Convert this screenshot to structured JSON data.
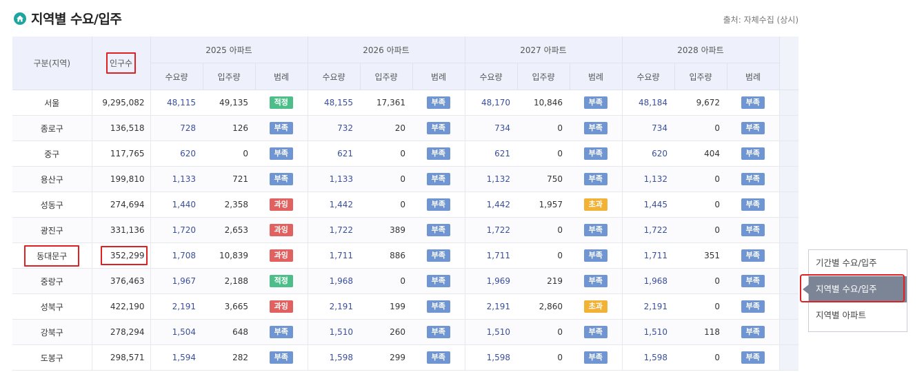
{
  "page": {
    "title": "지역별 수요/입주",
    "source": "출처: 자체수집 (상시)"
  },
  "table": {
    "col_region": "구분(지역)",
    "col_population": "인구수",
    "years": [
      "2025 아파트",
      "2026 아파트",
      "2027 아파트",
      "2028 아파트"
    ],
    "sub_demand": "수요량",
    "sub_supply": "입주량",
    "sub_legend": "범례",
    "rows": [
      {
        "region": "서울",
        "population": "9,295,082",
        "y": [
          [
            "48,115",
            "49,135",
            "적정"
          ],
          [
            "48,155",
            "17,361",
            "부족"
          ],
          [
            "48,170",
            "10,846",
            "부족"
          ],
          [
            "48,184",
            "9,672",
            "부족"
          ]
        ]
      },
      {
        "region": "종로구",
        "population": "136,518",
        "y": [
          [
            "728",
            "126",
            "부족"
          ],
          [
            "732",
            "20",
            "부족"
          ],
          [
            "734",
            "0",
            "부족"
          ],
          [
            "734",
            "0",
            "부족"
          ]
        ]
      },
      {
        "region": "중구",
        "population": "117,765",
        "y": [
          [
            "620",
            "0",
            "부족"
          ],
          [
            "621",
            "0",
            "부족"
          ],
          [
            "621",
            "0",
            "부족"
          ],
          [
            "620",
            "404",
            "부족"
          ]
        ]
      },
      {
        "region": "용산구",
        "population": "199,810",
        "y": [
          [
            "1,133",
            "721",
            "부족"
          ],
          [
            "1,133",
            "0",
            "부족"
          ],
          [
            "1,132",
            "750",
            "부족"
          ],
          [
            "1,132",
            "0",
            "부족"
          ]
        ]
      },
      {
        "region": "성동구",
        "population": "274,694",
        "y": [
          [
            "1,440",
            "2,358",
            "과잉"
          ],
          [
            "1,442",
            "0",
            "부족"
          ],
          [
            "1,442",
            "1,957",
            "초과"
          ],
          [
            "1,445",
            "0",
            "부족"
          ]
        ]
      },
      {
        "region": "광진구",
        "population": "331,136",
        "y": [
          [
            "1,720",
            "2,653",
            "과잉"
          ],
          [
            "1,722",
            "389",
            "부족"
          ],
          [
            "1,722",
            "0",
            "부족"
          ],
          [
            "1,722",
            "0",
            "부족"
          ]
        ]
      },
      {
        "region": "동대문구",
        "population": "352,299",
        "y": [
          [
            "1,708",
            "10,839",
            "과잉"
          ],
          [
            "1,711",
            "886",
            "부족"
          ],
          [
            "1,711",
            "0",
            "부족"
          ],
          [
            "1,711",
            "351",
            "부족"
          ]
        ]
      },
      {
        "region": "중랑구",
        "population": "376,463",
        "y": [
          [
            "1,967",
            "2,188",
            "적정"
          ],
          [
            "1,968",
            "0",
            "부족"
          ],
          [
            "1,969",
            "219",
            "부족"
          ],
          [
            "1,968",
            "0",
            "부족"
          ]
        ]
      },
      {
        "region": "성북구",
        "population": "422,190",
        "y": [
          [
            "2,191",
            "3,665",
            "과잉"
          ],
          [
            "2,191",
            "199",
            "부족"
          ],
          [
            "2,191",
            "2,860",
            "초과"
          ],
          [
            "2,191",
            "0",
            "부족"
          ]
        ]
      },
      {
        "region": "강북구",
        "population": "278,294",
        "y": [
          [
            "1,504",
            "648",
            "부족"
          ],
          [
            "1,510",
            "260",
            "부족"
          ],
          [
            "1,510",
            "0",
            "부족"
          ],
          [
            "1,510",
            "118",
            "부족"
          ]
        ]
      },
      {
        "region": "도봉구",
        "population": "298,571",
        "y": [
          [
            "1,594",
            "282",
            "부족"
          ],
          [
            "1,598",
            "299",
            "부족"
          ],
          [
            "1,598",
            "0",
            "부족"
          ],
          [
            "1,598",
            "0",
            "부족"
          ]
        ]
      }
    ]
  },
  "legend_colors": {
    "부족": "#6f95d3",
    "과잉": "#e0615f",
    "적정": "#4dbe8a",
    "초과": "#f1b236"
  },
  "side_menu": {
    "items": [
      "기간별 수요/입주",
      "지역별 수요/입주",
      "지역별 아파트"
    ],
    "active": 1
  },
  "icons": {
    "title_icon": "home-icon"
  }
}
